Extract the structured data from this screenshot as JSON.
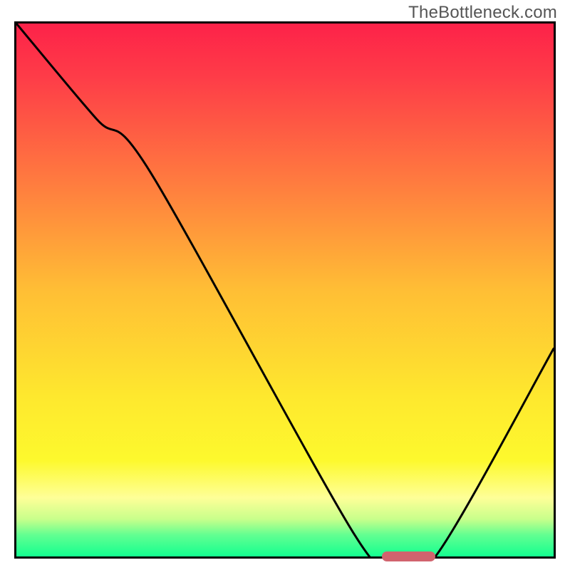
{
  "watermark": "TheBottleneck.com",
  "colors": {
    "gradient_top": "#fd2249",
    "gradient_bottom": "#14ff90",
    "curve": "#000000",
    "border": "#000000",
    "marker": "#d1636e"
  },
  "chart_data": {
    "type": "line",
    "title": "",
    "xlabel": "",
    "ylabel": "",
    "xlim": [
      0,
      100
    ],
    "ylim": [
      0,
      100
    ],
    "grid": false,
    "x": [
      0,
      15,
      25,
      63,
      70,
      78,
      100
    ],
    "values": [
      100,
      82,
      72,
      4,
      0,
      0,
      39
    ],
    "marker": {
      "x_start": 68,
      "x_end": 78,
      "y": 0
    },
    "annotations": []
  }
}
